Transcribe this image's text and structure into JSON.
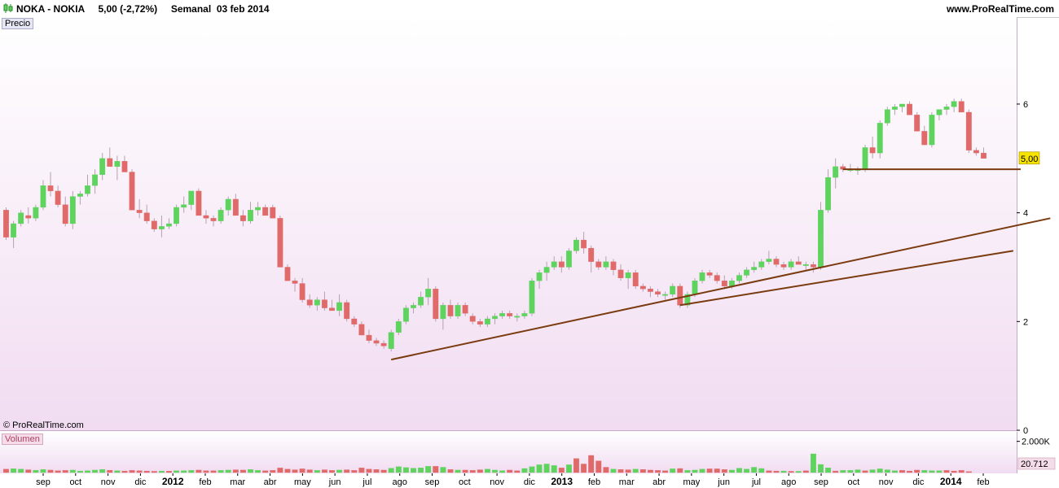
{
  "header": {
    "title": "NOKA - NOKIA     5,00 (-2,72%)     Semanal  03 feb 2014",
    "site": "www.ProRealTime.com"
  },
  "panels": {
    "price_label": "Precio",
    "volume_label": "Volumen",
    "copyright": "© ProRealTime.com",
    "last_price_tag": "5,00",
    "volume_axis_label": "2.000K",
    "last_volume_tag": "20.712"
  },
  "colors": {
    "up": "#5ed35e",
    "down": "#e06a6a",
    "trendline": "#7a3b10",
    "price_tag_bg": "#f7e300",
    "volume_tag_bg": "#f4dce8"
  },
  "chart_data": {
    "type": "candlestick",
    "title": "NOKA - NOKIA",
    "y_axis": {
      "ticks": [
        "0",
        "2",
        "4",
        "6"
      ],
      "ylim": [
        0,
        7.6
      ]
    },
    "x_axis_labels": [
      {
        "text": "sep",
        "bold": false
      },
      {
        "text": "oct",
        "bold": false
      },
      {
        "text": "nov",
        "bold": false
      },
      {
        "text": "dic",
        "bold": false
      },
      {
        "text": "2012",
        "bold": true
      },
      {
        "text": "feb",
        "bold": false
      },
      {
        "text": "mar",
        "bold": false
      },
      {
        "text": "abr",
        "bold": false
      },
      {
        "text": "may",
        "bold": false
      },
      {
        "text": "jun",
        "bold": false
      },
      {
        "text": "jul",
        "bold": false
      },
      {
        "text": "ago",
        "bold": false
      },
      {
        "text": "sep",
        "bold": false
      },
      {
        "text": "oct",
        "bold": false
      },
      {
        "text": "nov",
        "bold": false
      },
      {
        "text": "dic",
        "bold": false
      },
      {
        "text": "2013",
        "bold": true
      },
      {
        "text": "feb",
        "bold": false
      },
      {
        "text": "mar",
        "bold": false
      },
      {
        "text": "abr",
        "bold": false
      },
      {
        "text": "may",
        "bold": false
      },
      {
        "text": "jun",
        "bold": false
      },
      {
        "text": "jul",
        "bold": false
      },
      {
        "text": "ago",
        "bold": false
      },
      {
        "text": "sep",
        "bold": false
      },
      {
        "text": "oct",
        "bold": false
      },
      {
        "text": "nov",
        "bold": false
      },
      {
        "text": "dic",
        "bold": false
      },
      {
        "text": "2014",
        "bold": true
      },
      {
        "text": "feb",
        "bold": false
      }
    ],
    "candles_ohlc": [
      [
        4.05,
        4.1,
        3.5,
        3.55
      ],
      [
        3.55,
        3.85,
        3.35,
        3.8
      ],
      [
        3.8,
        4.05,
        3.75,
        4.0
      ],
      [
        3.95,
        4.1,
        3.8,
        3.9
      ],
      [
        3.9,
        4.15,
        3.85,
        4.1
      ],
      [
        4.1,
        4.6,
        4.05,
        4.5
      ],
      [
        4.5,
        4.75,
        4.3,
        4.4
      ],
      [
        4.4,
        4.5,
        4.1,
        4.15
      ],
      [
        4.15,
        4.3,
        3.75,
        3.8
      ],
      [
        3.8,
        4.4,
        3.7,
        4.3
      ],
      [
        4.3,
        4.4,
        4.15,
        4.35
      ],
      [
        4.35,
        4.7,
        4.3,
        4.5
      ],
      [
        4.5,
        4.8,
        4.35,
        4.7
      ],
      [
        4.7,
        5.1,
        4.6,
        5.0
      ],
      [
        5.0,
        5.2,
        4.85,
        4.85
      ],
      [
        4.85,
        5.05,
        4.6,
        4.95
      ],
      [
        4.95,
        5.05,
        4.75,
        4.75
      ],
      [
        4.75,
        4.8,
        4.05,
        4.05
      ],
      [
        4.05,
        4.25,
        3.9,
        4.0
      ],
      [
        4.0,
        4.15,
        3.8,
        3.85
      ],
      [
        3.85,
        3.9,
        3.65,
        3.7
      ],
      [
        3.7,
        3.95,
        3.55,
        3.75
      ],
      [
        3.75,
        3.9,
        3.7,
        3.8
      ],
      [
        3.8,
        4.15,
        3.75,
        4.1
      ],
      [
        4.1,
        4.3,
        4.0,
        4.15
      ],
      [
        4.15,
        4.4,
        4.05,
        4.4
      ],
      [
        4.4,
        4.45,
        3.95,
        3.95
      ],
      [
        3.95,
        4.05,
        3.8,
        3.9
      ],
      [
        3.9,
        3.95,
        3.75,
        3.85
      ],
      [
        3.85,
        4.1,
        3.8,
        4.05
      ],
      [
        4.05,
        4.3,
        3.95,
        4.25
      ],
      [
        4.25,
        4.35,
        3.95,
        3.95
      ],
      [
        3.95,
        4.05,
        3.75,
        3.85
      ],
      [
        3.85,
        4.2,
        3.8,
        4.05
      ],
      [
        4.05,
        4.2,
        3.95,
        4.1
      ],
      [
        4.1,
        4.15,
        3.95,
        3.95
      ],
      [
        4.1,
        4.15,
        3.9,
        3.9
      ],
      [
        3.9,
        3.95,
        3.0,
        3.0
      ],
      [
        3.0,
        3.05,
        2.75,
        2.75
      ],
      [
        2.75,
        2.8,
        2.55,
        2.7
      ],
      [
        2.7,
        2.8,
        2.35,
        2.4
      ],
      [
        2.4,
        2.5,
        2.25,
        2.3
      ],
      [
        2.3,
        2.45,
        2.2,
        2.4
      ],
      [
        2.4,
        2.55,
        2.2,
        2.25
      ],
      [
        2.25,
        2.4,
        2.2,
        2.2
      ],
      [
        2.2,
        2.5,
        2.1,
        2.35
      ],
      [
        2.35,
        2.4,
        2.0,
        2.05
      ],
      [
        2.05,
        2.1,
        1.9,
        1.95
      ],
      [
        1.95,
        2.0,
        1.75,
        1.75
      ],
      [
        1.75,
        1.85,
        1.6,
        1.65
      ],
      [
        1.65,
        1.7,
        1.55,
        1.6
      ],
      [
        1.6,
        1.65,
        1.5,
        1.55
      ],
      [
        1.5,
        1.85,
        1.45,
        1.8
      ],
      [
        1.8,
        2.05,
        1.75,
        2.0
      ],
      [
        2.0,
        2.3,
        1.95,
        2.25
      ],
      [
        2.25,
        2.35,
        2.15,
        2.3
      ],
      [
        2.3,
        2.55,
        2.25,
        2.45
      ],
      [
        2.45,
        2.8,
        2.3,
        2.6
      ],
      [
        2.6,
        2.65,
        2.0,
        2.05
      ],
      [
        2.05,
        2.35,
        1.85,
        2.3
      ],
      [
        2.3,
        2.4,
        2.05,
        2.1
      ],
      [
        2.1,
        2.35,
        2.05,
        2.3
      ],
      [
        2.3,
        2.35,
        2.1,
        2.15
      ],
      [
        2.1,
        2.15,
        1.95,
        2.0
      ],
      [
        2.0,
        2.05,
        1.9,
        1.95
      ],
      [
        1.95,
        2.1,
        1.9,
        2.05
      ],
      [
        2.05,
        2.15,
        1.95,
        2.1
      ],
      [
        2.1,
        2.2,
        2.05,
        2.15
      ],
      [
        2.15,
        2.2,
        2.05,
        2.1
      ],
      [
        2.1,
        2.15,
        2.0,
        2.1
      ],
      [
        2.1,
        2.2,
        2.05,
        2.15
      ],
      [
        2.15,
        2.8,
        2.1,
        2.75
      ],
      [
        2.75,
        2.95,
        2.6,
        2.9
      ],
      [
        2.9,
        3.1,
        2.75,
        3.0
      ],
      [
        3.0,
        3.2,
        2.95,
        3.1
      ],
      [
        3.1,
        3.2,
        2.9,
        3.0
      ],
      [
        3.0,
        3.35,
        2.95,
        3.3
      ],
      [
        3.3,
        3.55,
        3.25,
        3.5
      ],
      [
        3.5,
        3.65,
        3.25,
        3.35
      ],
      [
        3.35,
        3.4,
        2.9,
        3.1
      ],
      [
        3.1,
        3.15,
        2.95,
        3.0
      ],
      [
        3.0,
        3.2,
        2.95,
        3.1
      ],
      [
        3.1,
        3.15,
        2.85,
        2.95
      ],
      [
        2.95,
        3.05,
        2.75,
        2.8
      ],
      [
        2.8,
        2.95,
        2.6,
        2.9
      ],
      [
        2.9,
        2.95,
        2.6,
        2.65
      ],
      [
        2.65,
        2.7,
        2.55,
        2.6
      ],
      [
        2.6,
        2.65,
        2.45,
        2.55
      ],
      [
        2.55,
        2.6,
        2.45,
        2.5
      ],
      [
        2.5,
        2.55,
        2.4,
        2.5
      ],
      [
        2.5,
        2.7,
        2.45,
        2.65
      ],
      [
        2.65,
        2.7,
        2.25,
        2.3
      ],
      [
        2.3,
        2.55,
        2.25,
        2.5
      ],
      [
        2.5,
        2.8,
        2.45,
        2.75
      ],
      [
        2.75,
        2.95,
        2.7,
        2.9
      ],
      [
        2.9,
        2.95,
        2.8,
        2.85
      ],
      [
        2.85,
        2.9,
        2.7,
        2.75
      ],
      [
        2.75,
        2.85,
        2.6,
        2.65
      ],
      [
        2.65,
        2.8,
        2.6,
        2.75
      ],
      [
        2.75,
        2.9,
        2.7,
        2.85
      ],
      [
        2.85,
        3.0,
        2.8,
        2.95
      ],
      [
        2.95,
        3.1,
        2.9,
        3.0
      ],
      [
        3.0,
        3.15,
        2.95,
        3.1
      ],
      [
        3.1,
        3.3,
        3.05,
        3.15
      ],
      [
        3.15,
        3.2,
        3.0,
        3.05
      ],
      [
        3.05,
        3.1,
        2.95,
        3.0
      ],
      [
        3.0,
        3.15,
        2.95,
        3.1
      ],
      [
        3.1,
        3.2,
        3.05,
        3.05
      ],
      [
        3.05,
        3.1,
        2.95,
        3.05
      ],
      [
        3.05,
        3.1,
        2.9,
        3.0
      ],
      [
        3.0,
        4.2,
        2.95,
        4.05
      ],
      [
        4.05,
        4.8,
        4.0,
        4.65
      ],
      [
        4.65,
        5.0,
        4.45,
        4.85
      ],
      [
        4.85,
        4.9,
        4.75,
        4.8
      ],
      [
        4.8,
        4.9,
        4.75,
        4.8
      ],
      [
        4.8,
        4.85,
        4.7,
        4.8
      ],
      [
        4.8,
        5.25,
        4.75,
        5.2
      ],
      [
        5.2,
        5.4,
        5.0,
        5.1
      ],
      [
        5.1,
        5.7,
        5.0,
        5.65
      ],
      [
        5.65,
        5.95,
        5.6,
        5.9
      ],
      [
        5.9,
        6.0,
        5.8,
        5.95
      ],
      [
        5.95,
        6.0,
        5.85,
        6.0
      ],
      [
        6.0,
        6.05,
        5.8,
        5.8
      ],
      [
        5.8,
        5.85,
        5.5,
        5.5
      ],
      [
        5.5,
        5.6,
        5.25,
        5.25
      ],
      [
        5.25,
        5.85,
        5.2,
        5.8
      ],
      [
        5.8,
        5.9,
        5.7,
        5.9
      ],
      [
        5.9,
        6.0,
        5.8,
        5.95
      ],
      [
        5.95,
        6.1,
        5.85,
        6.05
      ],
      [
        6.05,
        6.1,
        5.85,
        5.85
      ],
      [
        5.85,
        5.9,
        5.1,
        5.15
      ],
      [
        5.15,
        5.2,
        5.05,
        5.1
      ],
      [
        5.1,
        5.2,
        5.0,
        5.0
      ]
    ],
    "volume_bars": [
      {
        "v": 0.22,
        "up": false
      },
      {
        "v": 0.25,
        "up": true
      },
      {
        "v": 0.22,
        "up": true
      },
      {
        "v": 0.18,
        "up": false
      },
      {
        "v": 0.15,
        "up": true
      },
      {
        "v": 0.2,
        "up": true
      },
      {
        "v": 0.16,
        "up": false
      },
      {
        "v": 0.12,
        "up": false
      },
      {
        "v": 0.14,
        "up": false
      },
      {
        "v": 0.16,
        "up": true
      },
      {
        "v": 0.1,
        "up": true
      },
      {
        "v": 0.12,
        "up": true
      },
      {
        "v": 0.16,
        "up": true
      },
      {
        "v": 0.2,
        "up": true
      },
      {
        "v": 0.15,
        "up": false
      },
      {
        "v": 0.12,
        "up": true
      },
      {
        "v": 0.1,
        "up": false
      },
      {
        "v": 0.14,
        "up": false
      },
      {
        "v": 0.12,
        "up": false
      },
      {
        "v": 0.1,
        "up": false
      },
      {
        "v": 0.08,
        "up": false
      },
      {
        "v": 0.1,
        "up": true
      },
      {
        "v": 0.09,
        "up": false
      },
      {
        "v": 0.12,
        "up": true
      },
      {
        "v": 0.12,
        "up": true
      },
      {
        "v": 0.14,
        "up": true
      },
      {
        "v": 0.16,
        "up": false
      },
      {
        "v": 0.12,
        "up": false
      },
      {
        "v": 0.12,
        "up": false
      },
      {
        "v": 0.14,
        "up": true
      },
      {
        "v": 0.16,
        "up": true
      },
      {
        "v": 0.18,
        "up": false
      },
      {
        "v": 0.16,
        "up": false
      },
      {
        "v": 0.2,
        "up": true
      },
      {
        "v": 0.14,
        "up": true
      },
      {
        "v": 0.12,
        "up": false
      },
      {
        "v": 0.14,
        "up": false
      },
      {
        "v": 0.3,
        "up": false
      },
      {
        "v": 0.22,
        "up": false
      },
      {
        "v": 0.18,
        "up": false
      },
      {
        "v": 0.24,
        "up": false
      },
      {
        "v": 0.18,
        "up": false
      },
      {
        "v": 0.14,
        "up": true
      },
      {
        "v": 0.18,
        "up": false
      },
      {
        "v": 0.14,
        "up": false
      },
      {
        "v": 0.16,
        "up": true
      },
      {
        "v": 0.18,
        "up": false
      },
      {
        "v": 0.14,
        "up": false
      },
      {
        "v": 0.3,
        "up": false
      },
      {
        "v": 0.22,
        "up": false
      },
      {
        "v": 0.2,
        "up": false
      },
      {
        "v": 0.16,
        "up": false
      },
      {
        "v": 0.28,
        "up": true
      },
      {
        "v": 0.38,
        "up": true
      },
      {
        "v": 0.32,
        "up": true
      },
      {
        "v": 0.28,
        "up": true
      },
      {
        "v": 0.3,
        "up": true
      },
      {
        "v": 0.4,
        "up": true
      },
      {
        "v": 0.4,
        "up": false
      },
      {
        "v": 0.34,
        "up": true
      },
      {
        "v": 0.2,
        "up": false
      },
      {
        "v": 0.16,
        "up": true
      },
      {
        "v": 0.16,
        "up": false
      },
      {
        "v": 0.14,
        "up": false
      },
      {
        "v": 0.18,
        "up": false
      },
      {
        "v": 0.22,
        "up": true
      },
      {
        "v": 0.16,
        "up": true
      },
      {
        "v": 0.12,
        "up": true
      },
      {
        "v": 0.16,
        "up": false
      },
      {
        "v": 0.12,
        "up": false
      },
      {
        "v": 0.26,
        "up": true
      },
      {
        "v": 0.38,
        "up": true
      },
      {
        "v": 0.5,
        "up": true
      },
      {
        "v": 0.55,
        "up": true
      },
      {
        "v": 0.45,
        "up": true
      },
      {
        "v": 0.3,
        "up": false
      },
      {
        "v": 0.5,
        "up": true
      },
      {
        "v": 0.9,
        "up": false
      },
      {
        "v": 0.55,
        "up": false
      },
      {
        "v": 1.1,
        "up": false
      },
      {
        "v": 0.75,
        "up": false
      },
      {
        "v": 0.34,
        "up": false
      },
      {
        "v": 0.22,
        "up": true
      },
      {
        "v": 0.2,
        "up": false
      },
      {
        "v": 0.18,
        "up": false
      },
      {
        "v": 0.22,
        "up": true
      },
      {
        "v": 0.2,
        "up": false
      },
      {
        "v": 0.16,
        "up": false
      },
      {
        "v": 0.14,
        "up": false
      },
      {
        "v": 0.12,
        "up": false
      },
      {
        "v": 0.24,
        "up": true
      },
      {
        "v": 0.26,
        "up": false
      },
      {
        "v": 0.14,
        "up": true
      },
      {
        "v": 0.16,
        "up": true
      },
      {
        "v": 0.22,
        "up": true
      },
      {
        "v": 0.24,
        "up": false
      },
      {
        "v": 0.24,
        "up": false
      },
      {
        "v": 0.2,
        "up": false
      },
      {
        "v": 0.16,
        "up": true
      },
      {
        "v": 0.28,
        "up": true
      },
      {
        "v": 0.22,
        "up": true
      },
      {
        "v": 0.34,
        "up": true
      },
      {
        "v": 0.26,
        "up": true
      },
      {
        "v": 0.12,
        "up": false
      },
      {
        "v": 0.1,
        "up": false
      },
      {
        "v": 0.1,
        "up": true
      },
      {
        "v": 0.08,
        "up": false
      },
      {
        "v": 0.08,
        "up": true
      },
      {
        "v": 0.12,
        "up": false
      },
      {
        "v": 1.2,
        "up": true
      },
      {
        "v": 0.52,
        "up": true
      },
      {
        "v": 0.3,
        "up": true
      },
      {
        "v": 0.1,
        "up": false
      },
      {
        "v": 0.14,
        "up": true
      },
      {
        "v": 0.14,
        "up": true
      },
      {
        "v": 0.18,
        "up": true
      },
      {
        "v": 0.12,
        "up": false
      },
      {
        "v": 0.18,
        "up": true
      },
      {
        "v": 0.24,
        "up": true
      },
      {
        "v": 0.18,
        "up": true
      },
      {
        "v": 0.12,
        "up": true
      },
      {
        "v": 0.14,
        "up": false
      },
      {
        "v": 0.1,
        "up": false
      },
      {
        "v": 0.16,
        "up": false
      },
      {
        "v": 0.14,
        "up": true
      },
      {
        "v": 0.12,
        "up": true
      },
      {
        "v": 0.12,
        "up": true
      },
      {
        "v": 0.14,
        "up": false
      },
      {
        "v": 0.1,
        "up": false
      },
      {
        "v": 0.14,
        "up": false
      },
      {
        "v": 0.06,
        "up": false
      }
    ],
    "horizontal_line": {
      "start_index": 113,
      "end_index": 137,
      "value": 4.8
    },
    "trendlines": [
      {
        "from_index": 52,
        "from_value": 1.3,
        "to_index": 141,
        "to_value": 3.9
      },
      {
        "from_index": 91,
        "from_value": 2.3,
        "to_index": 136,
        "to_value": 3.3
      }
    ],
    "last_price": 5.0,
    "volume_ylim": [
      0,
      2.4
    ]
  }
}
